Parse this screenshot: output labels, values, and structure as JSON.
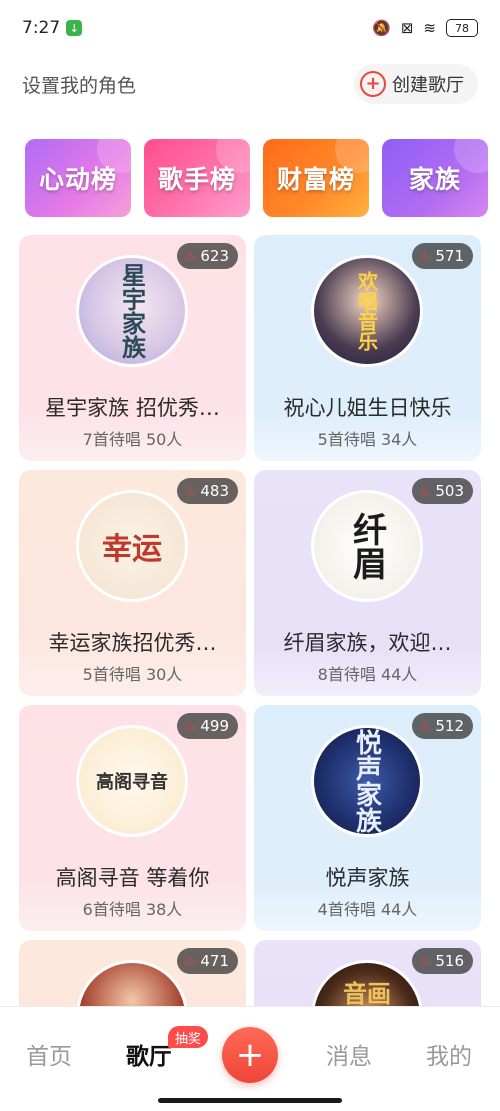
{
  "status": {
    "time": "7:27",
    "battery": "78"
  },
  "header": {
    "role_text": "设置我的角色",
    "create_label": "创建歌厅"
  },
  "ranks": [
    {
      "label": "心动榜"
    },
    {
      "label": "歌手榜"
    },
    {
      "label": "财富榜"
    },
    {
      "label": "家族"
    }
  ],
  "rooms": [
    {
      "heat": "623",
      "avatar_text": "星宇家族",
      "title": "星宇家族  招优秀…",
      "sub": "7首待唱 50人"
    },
    {
      "heat": "571",
      "avatar_text": "欢唱音乐",
      "title": "祝心儿姐生日快乐",
      "sub": "5首待唱 34人"
    },
    {
      "heat": "483",
      "avatar_text": "幸运",
      "title": "幸运家族招优秀…",
      "sub": "5首待唱 30人"
    },
    {
      "heat": "503",
      "avatar_text": "纤眉",
      "title": "纤眉家族，欢迎…",
      "sub": "8首待唱 44人"
    },
    {
      "heat": "499",
      "avatar_text": "高阁寻音",
      "title": "高阁寻音  等着你",
      "sub": "6首待唱 38人"
    },
    {
      "heat": "512",
      "avatar_text": "悦声家族",
      "title": "悦声家族",
      "sub": "4首待唱 44人"
    },
    {
      "heat": "471",
      "avatar_text": "",
      "title": "",
      "sub": ""
    },
    {
      "heat": "516",
      "avatar_text": "音画",
      "title": "",
      "sub": ""
    }
  ],
  "nav": {
    "home": "首页",
    "hall": "歌厅",
    "lottery": "抽奖",
    "add": "+",
    "messages": "消息",
    "me": "我的"
  },
  "colors": {
    "accent": "#f0453a"
  }
}
